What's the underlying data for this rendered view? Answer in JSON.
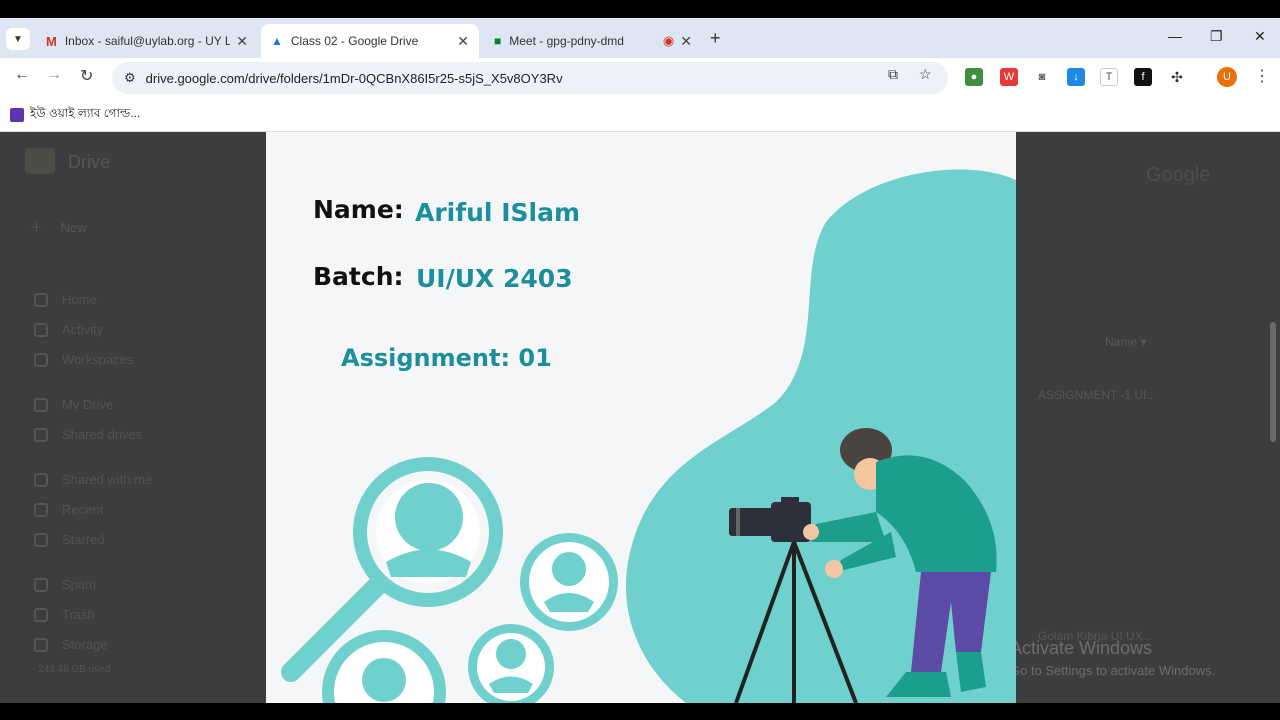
{
  "browser": {
    "tabs": [
      {
        "title": "Inbox - saiful@uylab.org - UY L",
        "icon": "gmail-icon",
        "active": false
      },
      {
        "title": "Class 02 - Google Drive",
        "icon": "drive-icon",
        "active": true
      },
      {
        "title": "Meet - gpg-pdny-dmd",
        "icon": "meet-icon",
        "active": false
      }
    ],
    "url": "drive.google.com/drive/folders/1mDr-0QCBnX86I5r25-s5jS_X5v8OY3Rv",
    "bookmark": "ইউ ওয়াই ল্যাব গোল্ড...",
    "avatar_letter": "U",
    "colors": {
      "tabbar": "#dfe6f3",
      "accent": "#1c8e9c",
      "teal": "#6fd0cd"
    }
  },
  "drive": {
    "brand": "Drive",
    "new_label": "New",
    "sidebar": [
      "Home",
      "Activity",
      "Workspaces",
      "My Drive",
      "Shared drives",
      "Shared with me",
      "Recent",
      "Starred",
      "Spam",
      "Trash",
      "Storage"
    ],
    "storage_text": "243.48 GB used",
    "sort_label": "Name",
    "files": [
      "ASSIGNMENT -1 UI...",
      "Golam Kibria UI UX..."
    ]
  },
  "slide": {
    "name_label": "Name:",
    "name_value": "Ariful ISlam",
    "batch_label": "Batch:",
    "batch_value": "UI/UX 2403",
    "assignment": "Assignment: 01"
  },
  "watermark": {
    "line1": "Activate Windows",
    "line2": "Go to Settings to activate Windows."
  }
}
